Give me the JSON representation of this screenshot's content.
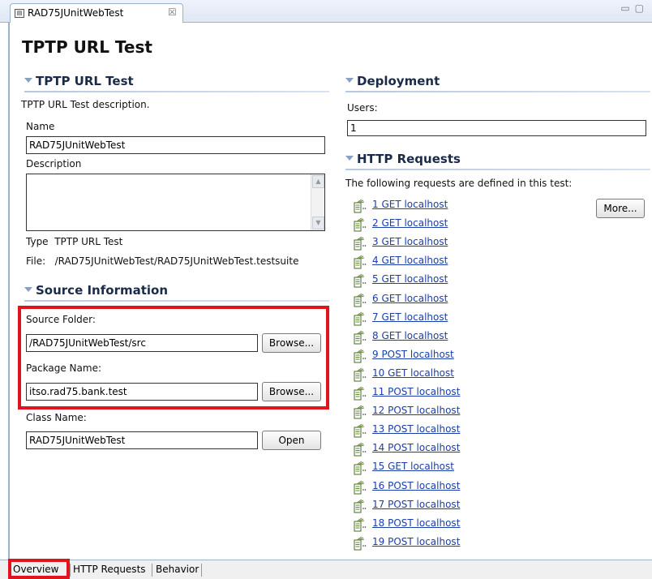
{
  "editor_tab": {
    "title": "RAD75JUnitWebTest",
    "icon": "test-suite-icon",
    "close_glyph": "☒"
  },
  "window_controls": {
    "minimize": "▭",
    "maximize": "▢"
  },
  "page_title": "TPTP URL Test",
  "tptp_section": {
    "header": "TPTP URL Test",
    "description_text": "TPTP URL Test description.",
    "name_label": "Name",
    "name_value": "RAD75JUnitWebTest",
    "description_label": "Description",
    "description_value": "",
    "type_text": "Type  TPTP URL Test",
    "file_text": "File:   /RAD75JUnitWebTest/RAD75JUnitWebTest.testsuite"
  },
  "source_section": {
    "header": "Source Information",
    "source_folder_label": "Source Folder:",
    "source_folder_value": "/RAD75JUnitWebTest/src",
    "package_name_label": "Package Name:",
    "package_name_value": "itso.rad75.bank.test",
    "class_name_label": "Class Name:",
    "class_name_value": "RAD75JUnitWebTest",
    "browse_label": "Browse...",
    "open_label": "Open"
  },
  "deployment_section": {
    "header": "Deployment",
    "users_label": "Users:",
    "users_value": "1"
  },
  "http_section": {
    "header": "HTTP Requests",
    "intro": "The following requests are defined in this test:",
    "more_label": "More...",
    "requests": [
      "1 GET localhost",
      "2 GET localhost",
      "3 GET localhost",
      "4 GET localhost",
      "5 GET localhost",
      "6 GET localhost",
      "7 GET localhost",
      "8 GET localhost",
      "9 POST localhost",
      "10 GET localhost",
      "11 POST localhost",
      "12 POST localhost",
      "13 POST localhost",
      "14 POST localhost",
      "15 GET localhost",
      "16 POST localhost",
      "17 POST localhost",
      "18 POST localhost",
      "19 POST localhost"
    ]
  },
  "bottom_tabs": [
    "Overview",
    "HTTP Requests",
    "Behavior"
  ],
  "colors": {
    "highlight": "#e0141e",
    "link": "#1b3ea8",
    "section_text": "#1a2b4a"
  }
}
